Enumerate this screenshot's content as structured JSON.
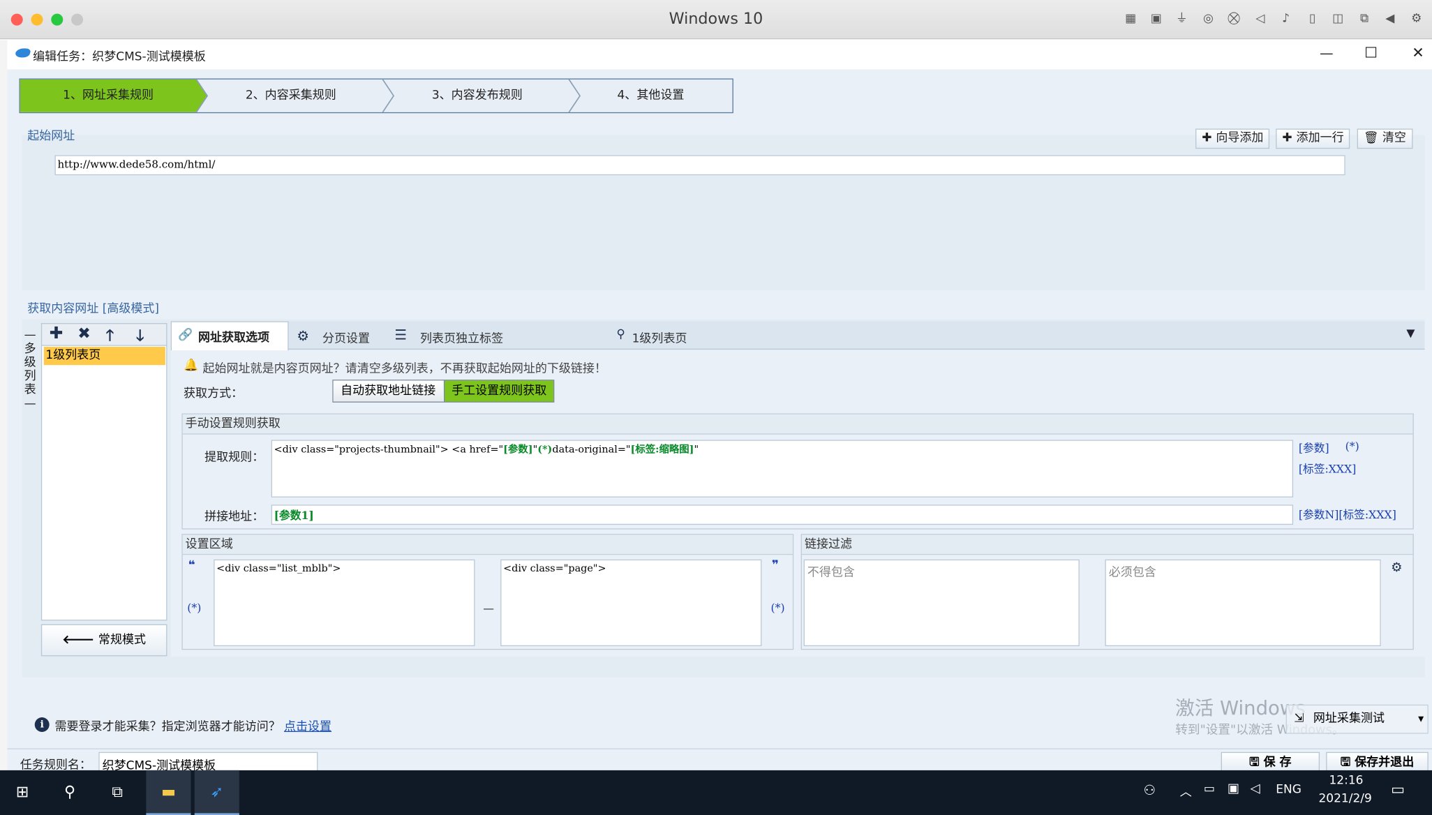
{
  "mac": {
    "title": "Windows 10",
    "icons": [
      "keyboard-icon",
      "cpu-icon",
      "usb-icon",
      "disc-icon",
      "network-off-icon",
      "speaker-icon",
      "microphone-icon",
      "phone-icon",
      "camera-icon",
      "folder-share-icon",
      "back-icon",
      "settings-icon"
    ],
    "colors": {
      "close": "#ff5f57",
      "min": "#febc2e",
      "max": "#28c840",
      "disabled": "#c8c8c8"
    }
  },
  "window": {
    "title": "编辑任务：织梦CMS-测试模模板",
    "controls": {
      "minimize": "—",
      "maximize": "☐",
      "close": "✕"
    }
  },
  "steps": [
    {
      "label": "1、网址采集规则",
      "active": true
    },
    {
      "label": "2、内容采集规则",
      "active": false
    },
    {
      "label": "3、内容发布规则",
      "active": false
    },
    {
      "label": "4、其他设置",
      "active": false
    }
  ],
  "start_url": {
    "section_title": "起始网址",
    "add_wizard": "向导添加",
    "add_row": "添加一行",
    "clear": "清空",
    "url": "http://www.dede58.com/html/"
  },
  "content_url": {
    "section_title": "获取内容网址 [高级模式]",
    "side_label": "多级列表",
    "list_items": [
      "1级列表页"
    ],
    "normal_mode": "常规模式"
  },
  "tabs": [
    {
      "label": "网址获取选项",
      "active": true
    },
    {
      "label": "分页设置",
      "active": false
    },
    {
      "label": "列表页独立标签",
      "active": false
    },
    {
      "label": "1级列表页",
      "active": false
    }
  ],
  "notice": "起始网址就是内容页网址？请清空多级列表，不再获取起始网址的下级链接！",
  "fetch": {
    "label": "获取方式：",
    "opt_auto": "自动获取地址链接",
    "opt_manual": "手工设置规则获取"
  },
  "manual": {
    "title": "手动设置规则获取",
    "rule_label": "提取规则：",
    "rule_p1": "<div class=\"projects-thumbnail\"> <a href=\"",
    "rule_p2": "[参数]",
    "rule_p3": "\"",
    "rule_p4": "(*)",
    "rule_p5": "data-original=\"",
    "rule_p6": "[标签:缩略图]",
    "rule_p7": "\"",
    "side_param": "[参数]",
    "side_star": "(*)",
    "side_tag": "[标签:XXX]",
    "join_label": "拼接地址：",
    "join_value": "[参数1]",
    "join_side": "[参数N][标签:XXX]"
  },
  "region": {
    "title": "设置区域",
    "open_quote": "❝",
    "close_quote": "❞",
    "star_left": "(*)",
    "star_right": "(*)",
    "start": "<div  class=\"list_mblb\">",
    "end": "<div  class=\"page\">",
    "dash": "—"
  },
  "filter": {
    "title": "链接过滤",
    "exclude_placeholder": "不得包含",
    "include_placeholder": "必须包含"
  },
  "login": {
    "text": "需要登录才能采集？指定浏览器才能访问？",
    "link": "点击设置"
  },
  "test_button": "网址采集测试",
  "watermark": {
    "line1": "激活 Windows",
    "line2": "转到\"设置\"以激活 Windows。"
  },
  "task": {
    "label": "任务规则名：",
    "value": "织梦CMS-测试模模板",
    "save": "保 存",
    "save_exit": "保存并退出"
  },
  "taskbar": {
    "time": "12:16",
    "date": "2021/2/9",
    "lang": "ENG",
    "icons": [
      "windows-start-icon",
      "search-icon",
      "task-view-icon",
      "file-explorer-icon",
      "app-bird-icon"
    ],
    "tray": [
      "people-icon",
      "chevron-up-icon",
      "battery-icon",
      "network-icon",
      "volume-icon",
      "notification-icon"
    ]
  },
  "colors": {
    "accent_green": "#7dc41c",
    "active_list": "#ffc94a",
    "link_blue": "#1a4fb5",
    "taskbar": "#101a26",
    "content_bg": "#e9f0f7"
  }
}
